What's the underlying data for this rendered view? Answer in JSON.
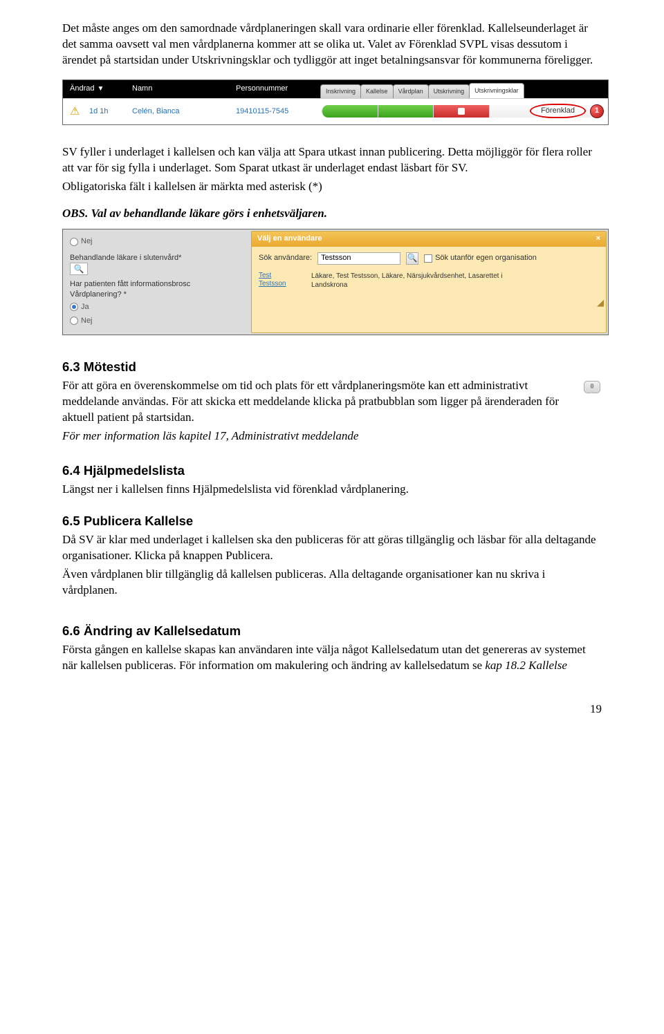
{
  "intro": {
    "p1": "Det måste anges om den samordnade vårdplaneringen skall vara ordinarie eller förenklad. Kallelseunderlaget är det samma oavsett val men vårdplanerna kommer att se olika ut. Valet av Förenklad SVPL visas dessutom i ärendet på startsidan under Utskrivningsklar och tydliggör att inget betalningsansvar för kommunerna föreligger."
  },
  "shot1": {
    "headers": {
      "andrad": "Ändrad",
      "namn": "Namn",
      "pnr": "Personnummer"
    },
    "tabs": [
      "Inskrivning",
      "Kallelse",
      "Vårdplan",
      "Utskrivning",
      "Utskrivningsklar"
    ],
    "row": {
      "warnGlyph": "⚠",
      "andrad": "1d 1h",
      "namn": "Celén, Bianca",
      "pnr": "19410115-7545",
      "forenklad": "Förenklad",
      "badge": "1"
    }
  },
  "mid": {
    "p1": "SV fyller i underlaget i kallelsen och kan välja att Spara utkast innan publicering. Detta möjliggör för flera roller att var för sig fylla i underlaget. Som Sparat utkast är underlaget endast läsbart för SV.",
    "p2": "Obligatoriska fält i kallelsen är märkta med asterisk (*)",
    "obs": "OBS. Val av behandlande läkare görs i enhetsväljaren."
  },
  "shot2": {
    "left": {
      "radioNej1": "Nej",
      "label1": "Behandlande läkare i slutenvård*",
      "label2a": "Har patienten fått informationsbrosc",
      "label2b": "Vårdplanering? *",
      "radioJa": "Ja",
      "radioNej2": "Nej",
      "magGlyph": "🔍"
    },
    "right": {
      "title": "Välj en användare",
      "close": "×",
      "searchLabel": "Sök användare:",
      "searchValue": "Testsson",
      "magGlyph": "🔍",
      "extChk": "Sök utanför egen organisation",
      "linkTop": "Test",
      "linkBot": "Testsson",
      "resultLine1": "Läkare, Test Testsson, Läkare, Närsjukvårdsenhet, Lasarettet i",
      "resultLine2": "Landskrona",
      "resizer": "◢"
    }
  },
  "s63": {
    "heading": "6.3 Mötestid",
    "p1": "För att göra en överenskommelse om tid och plats för ett vårdplaneringsmöte kan ett administrativt meddelande användas. För att skicka ett meddelande klicka på pratbubblan som ligger på ärenderaden för aktuell patient på startsidan.",
    "p2": "För mer information läs kapitel 17, Administrativt meddelande",
    "bubbleCount": "0"
  },
  "s64": {
    "heading": "6.4 Hjälpmedelslista",
    "p1": "Längst ner i kallelsen finns Hjälpmedelslista vid förenklad vårdplanering."
  },
  "s65": {
    "heading": "6.5 Publicera Kallelse",
    "p1": "Då SV är klar med underlaget i kallelsen ska den publiceras för att göras tillgänglig och läsbar för alla deltagande organisationer. Klicka på knappen Publicera.",
    "p2": "Även vårdplanen blir tillgänglig då kallelsen publiceras. Alla deltagande organisationer kan nu skriva i vårdplanen."
  },
  "s66": {
    "heading": "6.6 Ändring av Kallelsedatum",
    "p1a": "Första gången en kallelse skapas kan användaren inte välja något Kallelsedatum utan det genereras av systemet när kallelsen publiceras. För information om makulering och ändring av kallelsedatum se ",
    "p1b": "kap 18.2 Kallelse"
  },
  "pageNum": "19"
}
